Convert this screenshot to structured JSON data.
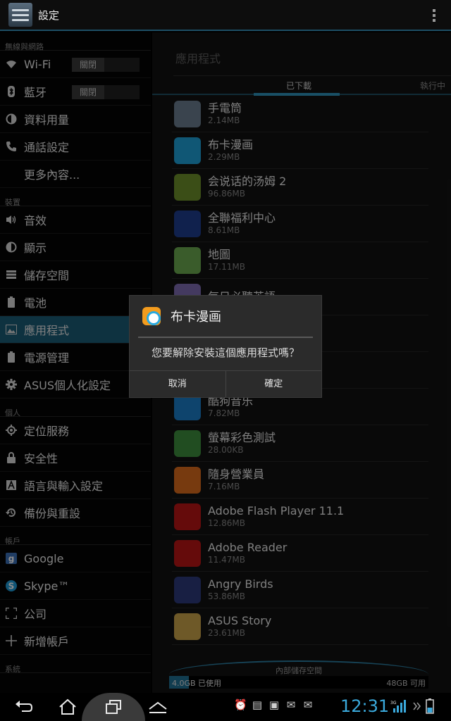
{
  "actionbar": {
    "title": "設定"
  },
  "left": {
    "sections": {
      "wireless": "無線與網路",
      "device": "裝置",
      "personal": "個人",
      "accounts": "帳戶",
      "system": "系統"
    },
    "wifi": {
      "label": "Wi-Fi",
      "toggle": "關閉"
    },
    "bluetooth": {
      "label": "藍牙",
      "toggle": "關閉"
    },
    "data_usage": "資料用量",
    "call_settings": "通話設定",
    "more": "更多內容...",
    "sound": "音效",
    "display": "顯示",
    "storage": "儲存空間",
    "battery": "電池",
    "apps": "應用程式",
    "power": "電源管理",
    "asus": "ASUS個人化設定",
    "location": "定位服務",
    "security": "安全性",
    "language": "語言與輸入設定",
    "backup": "備份與重設",
    "google": "Google",
    "skype": "Skype™",
    "company": "公司",
    "add_account": "新增帳戶"
  },
  "right": {
    "title": "應用程式",
    "tabs": {
      "downloaded": "已下載",
      "running": "執行中"
    },
    "apps": [
      {
        "name": "手電筒",
        "size": "2.14MB",
        "color": "#6a7d8f"
      },
      {
        "name": "布卡漫画",
        "size": "2.29MB",
        "color": "#1e9fd6"
      },
      {
        "name": "会说话的汤姆 2",
        "size": "96.86MB",
        "color": "#6c8f2a"
      },
      {
        "name": "全聯福利中心",
        "size": "8.61MB",
        "color": "#1e3c8c"
      },
      {
        "name": "地圖",
        "size": "17.11MB",
        "color": "#6aa84f"
      },
      {
        "name": "每日必聽英語",
        "size": "",
        "color": "#7c6bb0"
      },
      {
        "name": "",
        "size": "",
        "color": "transparent"
      },
      {
        "name": "",
        "size": "",
        "color": "transparent"
      },
      {
        "name": "酷狗音乐",
        "size": "7.82MB",
        "color": "#1a7cc6"
      },
      {
        "name": "螢幕彩色測試",
        "size": "28.00KB",
        "color": "#3c8d3c"
      },
      {
        "name": "隨身營業員",
        "size": "7.16MB",
        "color": "#d96b1c"
      },
      {
        "name": "Adobe Flash Player 11.1",
        "size": "12.86MB",
        "color": "#b81414"
      },
      {
        "name": "Adobe Reader",
        "size": "11.47MB",
        "color": "#b81414"
      },
      {
        "name": "Angry Birds",
        "size": "53.86MB",
        "color": "#2c3a7a"
      },
      {
        "name": "ASUS Story",
        "size": "23.61MB",
        "color": "#c9a24a"
      }
    ],
    "storage": {
      "label": "內部儲存空間",
      "used": "4.0GB 已使用",
      "free": "48GB 可用",
      "used_fraction": 0.077
    }
  },
  "dialog": {
    "title": "布卡漫画",
    "message": "您要解除安裝這個應用程式嗎？",
    "cancel": "取消",
    "ok": "確定"
  },
  "statusbar": {
    "time": "12:31"
  }
}
